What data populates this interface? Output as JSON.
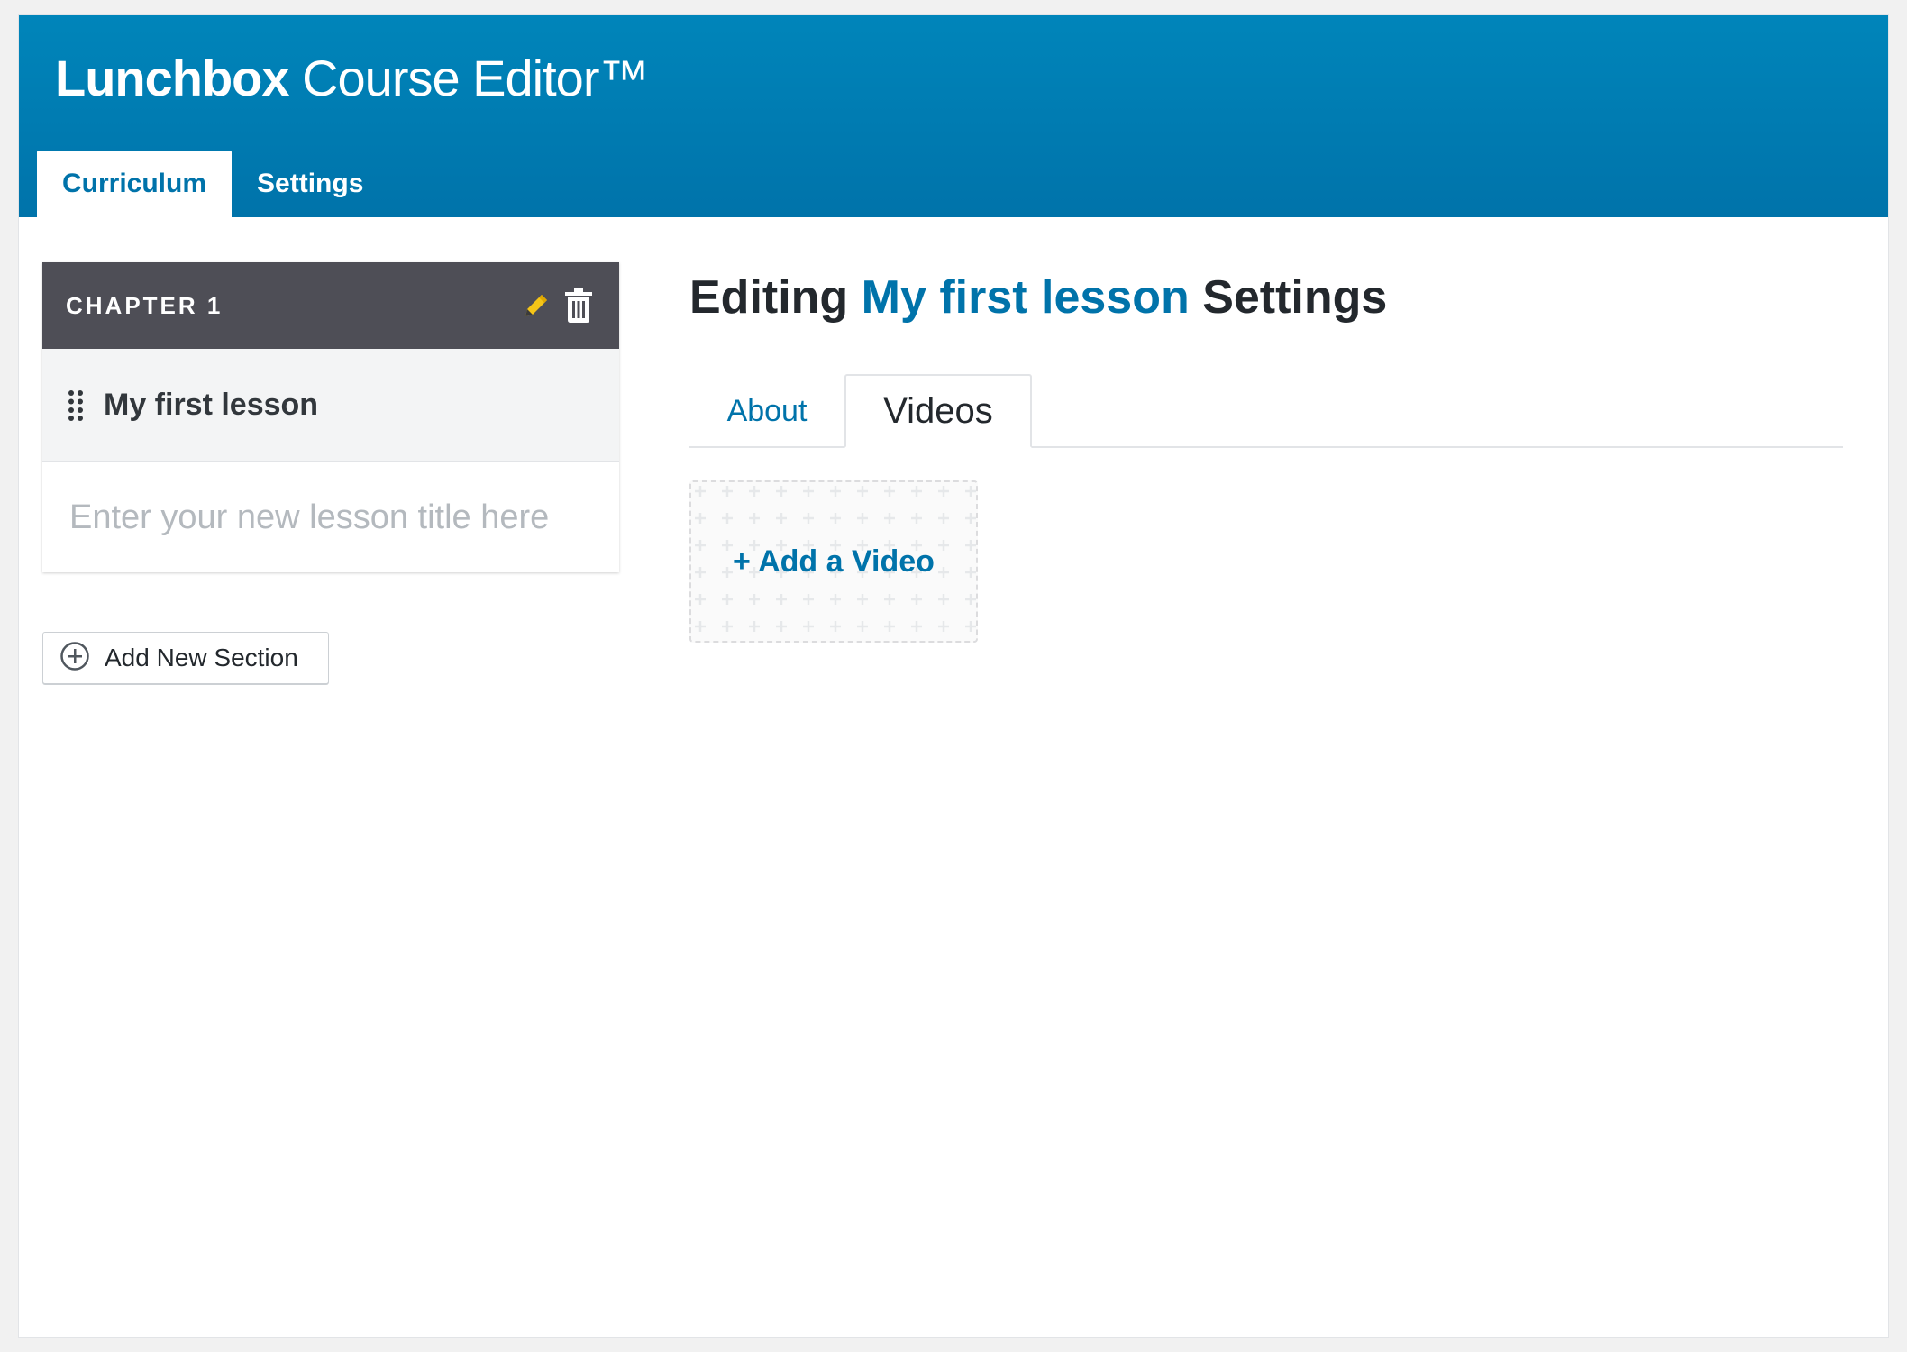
{
  "app": {
    "brand": "Lunchbox",
    "title_rest": " Course Editor",
    "trademark": "™"
  },
  "tabs": [
    {
      "label": "Curriculum",
      "active": true
    },
    {
      "label": "Settings",
      "active": false
    }
  ],
  "curriculum": {
    "chapter_title": "CHAPTER 1",
    "lessons": [
      {
        "title": "My first lesson"
      }
    ],
    "new_lesson_placeholder": "Enter your new lesson title here",
    "add_section_label": "Add New Section"
  },
  "editor": {
    "heading_prefix": "Editing ",
    "heading_lesson": "My first lesson",
    "heading_suffix": " Settings",
    "subtabs": [
      {
        "label": "About",
        "active": false
      },
      {
        "label": "Videos",
        "active": true
      }
    ],
    "add_video_label": "+ Add a Video"
  },
  "colors": {
    "header_blue": "#0085ba",
    "accent_blue": "#0073aa",
    "chapter_header": "#4e4e56",
    "pencil_yellow": "#f5c518"
  },
  "icons": {
    "edit": "pencil-icon",
    "delete": "trash-icon",
    "drag": "drag-handle-icon",
    "add": "plus-circle-icon"
  }
}
